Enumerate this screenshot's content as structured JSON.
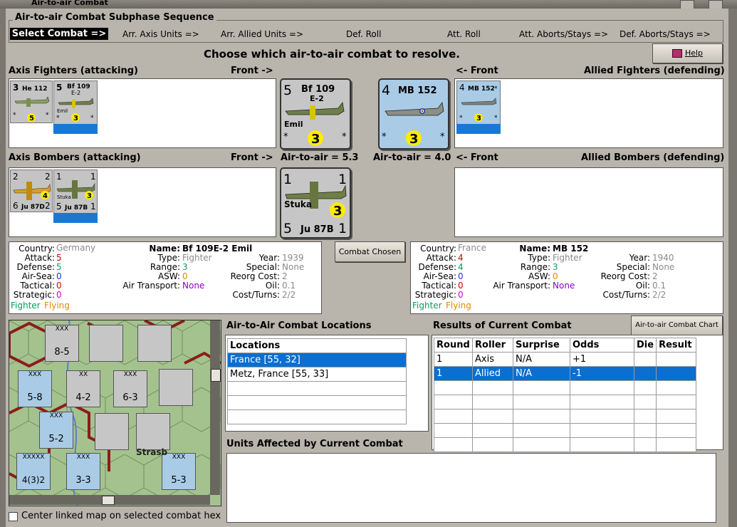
{
  "window": {
    "title": "Air-to-air Combat"
  },
  "sequence": {
    "title": "Air-to-air Combat Subphase Sequence",
    "steps": [
      "Select Combat =>",
      "Arr. Axis Units =>",
      "Arr. Allied Units =>",
      "Def. Roll",
      "Att. Roll",
      "Att. Aborts/Stays =>",
      "Def. Aborts/Stays =>"
    ]
  },
  "prompt": "Choose which air-to-air combat to resolve.",
  "help_label": "Help",
  "axis": {
    "fighters_title": "Axis Fighters (attacking)",
    "bombers_title": "Axis Bombers (attacking)",
    "front_label": "Front ->",
    "fighters": [
      {
        "name": "He 112",
        "top_left": "3",
        "bottom": "5",
        "stars": "*"
      },
      {
        "name": "Bf 109",
        "sub": "E-2",
        "nick": "Emil",
        "top_left": "5",
        "bottom": "3",
        "stars": "*"
      }
    ],
    "bombers": [
      {
        "name": "Ju 87D",
        "tl": "2",
        "tr": "2",
        "bl": "6",
        "br": "2",
        "circle": "4"
      },
      {
        "name": "Ju 87B",
        "nick": "Stuka",
        "tl": "1",
        "tr": "1",
        "bl": "5",
        "br": "1",
        "circle": "3"
      }
    ],
    "big_fighter": {
      "tl": "5",
      "name": "Bf 109",
      "sub": "E-2",
      "nick": "Emil",
      "circle": "3",
      "star": "*"
    },
    "big_bomber": {
      "tl": "1",
      "tr": "1",
      "nick": "Stuka",
      "circle": "3",
      "bl": "5",
      "name": "Ju 87B",
      "br": "1"
    },
    "air_to_air": "Air-to-air = 5.3"
  },
  "allied": {
    "fighters_title": "Allied Fighters (defending)",
    "bombers_title": "Allied Bombers (defending)",
    "front_label": "<- Front",
    "fighters": [
      {
        "name": "MB 152",
        "top_left": "4",
        "bottom": "3",
        "stars": "*"
      }
    ],
    "big_fighter": {
      "tl": "4",
      "name": "MB 152",
      "circle": "3",
      "star": "*"
    },
    "air_to_air": "Air-to-air = 4.0"
  },
  "axis_info": {
    "country_label": "Country:",
    "country": "Germany",
    "attack_label": "Attack:",
    "attack": "5",
    "defense_label": "Defense:",
    "defense": "5",
    "airsea_label": "Air-Sea:",
    "airsea": "0",
    "tactical_label": "Tactical:",
    "tactical": "0",
    "strategic_label": "Strategic:",
    "strategic": "0",
    "name_label": "Name:",
    "name": "Bf 109E-2 Emil",
    "type_label": "Type:",
    "type": "Fighter",
    "range_label": "Range:",
    "range": "3",
    "asw_label": "ASW:",
    "asw": "0",
    "airtrans_label": "Air Transport:",
    "airtrans": "None",
    "year_label": "Year:",
    "year": "1939",
    "special_label": "Special:",
    "special": "None",
    "reorg_label": "Reorg Cost:",
    "reorg": "2",
    "oil_label": "Oil:",
    "oil": "0.1",
    "cost_label": "Cost/Turns:",
    "cost": "2/2",
    "role": "Fighter",
    "status": "Flying"
  },
  "allied_info": {
    "country_label": "Country:",
    "country": "France",
    "attack_label": "Attack:",
    "attack": "4",
    "defense_label": "Defense:",
    "defense": "4",
    "airsea_label": "Air-Sea:",
    "airsea": "0",
    "tactical_label": "Tactical:",
    "tactical": "0",
    "strategic_label": "Strategic:",
    "strategic": "0",
    "name_label": "Name:",
    "name": "MB 152",
    "type_label": "Type:",
    "type": "Fighter",
    "range_label": "Range:",
    "range": "3",
    "asw_label": "ASW:",
    "asw": "0",
    "airtrans_label": "Air Transport:",
    "airtrans": "None",
    "year_label": "Year:",
    "year": "1940",
    "special_label": "Special:",
    "special": "None",
    "reorg_label": "Reorg Cost:",
    "reorg": "2",
    "oil_label": "Oil:",
    "oil": "0.1",
    "cost_label": "Cost/Turns:",
    "cost": "2/2",
    "role": "Fighter",
    "status": "Flying"
  },
  "combat_chosen_label": "Combat Chosen",
  "locations": {
    "title": "Air-to-Air Combat Locations",
    "header": "Locations",
    "rows": [
      "France [55, 32]",
      "Metz, France [55, 33]"
    ]
  },
  "results": {
    "title": "Results of Current Combat",
    "chart_button": "Air-to-air Combat Chart",
    "headers": [
      "Round",
      "Roller",
      "Surprise",
      "Odds",
      "Die",
      "Result"
    ],
    "rows": [
      [
        "1",
        "Axis",
        "N/A",
        "+1",
        "",
        ""
      ],
      [
        "1",
        "Allied",
        "N/A",
        "-1",
        "",
        ""
      ]
    ]
  },
  "affected_title": "Units Affected by Current Combat",
  "center_map_label": "Center linked map on selected combat hex",
  "colors": {
    "selected": "#0a6fd1",
    "panel": "#b9b4ac",
    "attack_red": "#d40000",
    "defense_green": "#0a9a5a",
    "blue_val": "#2233dd",
    "orange": "#e08a00",
    "magenta": "#d200d2",
    "grey": "#8a8a8a"
  },
  "map_units": [
    {
      "label": "XXX",
      "value": "8-5"
    },
    {
      "label": "XX",
      "value": "4-2"
    },
    {
      "label": "XXX",
      "value": "6-3"
    },
    {
      "label": "XXX",
      "value": "5-8"
    },
    {
      "label": "XXX",
      "value": "5-2"
    },
    {
      "label": "XXX",
      "value": "3-3"
    },
    {
      "label": "XXX",
      "value": "5-3"
    },
    {
      "label": "XXXXX",
      "value": "4(3)2"
    },
    {
      "label": "Strasb",
      "value": ""
    }
  ]
}
